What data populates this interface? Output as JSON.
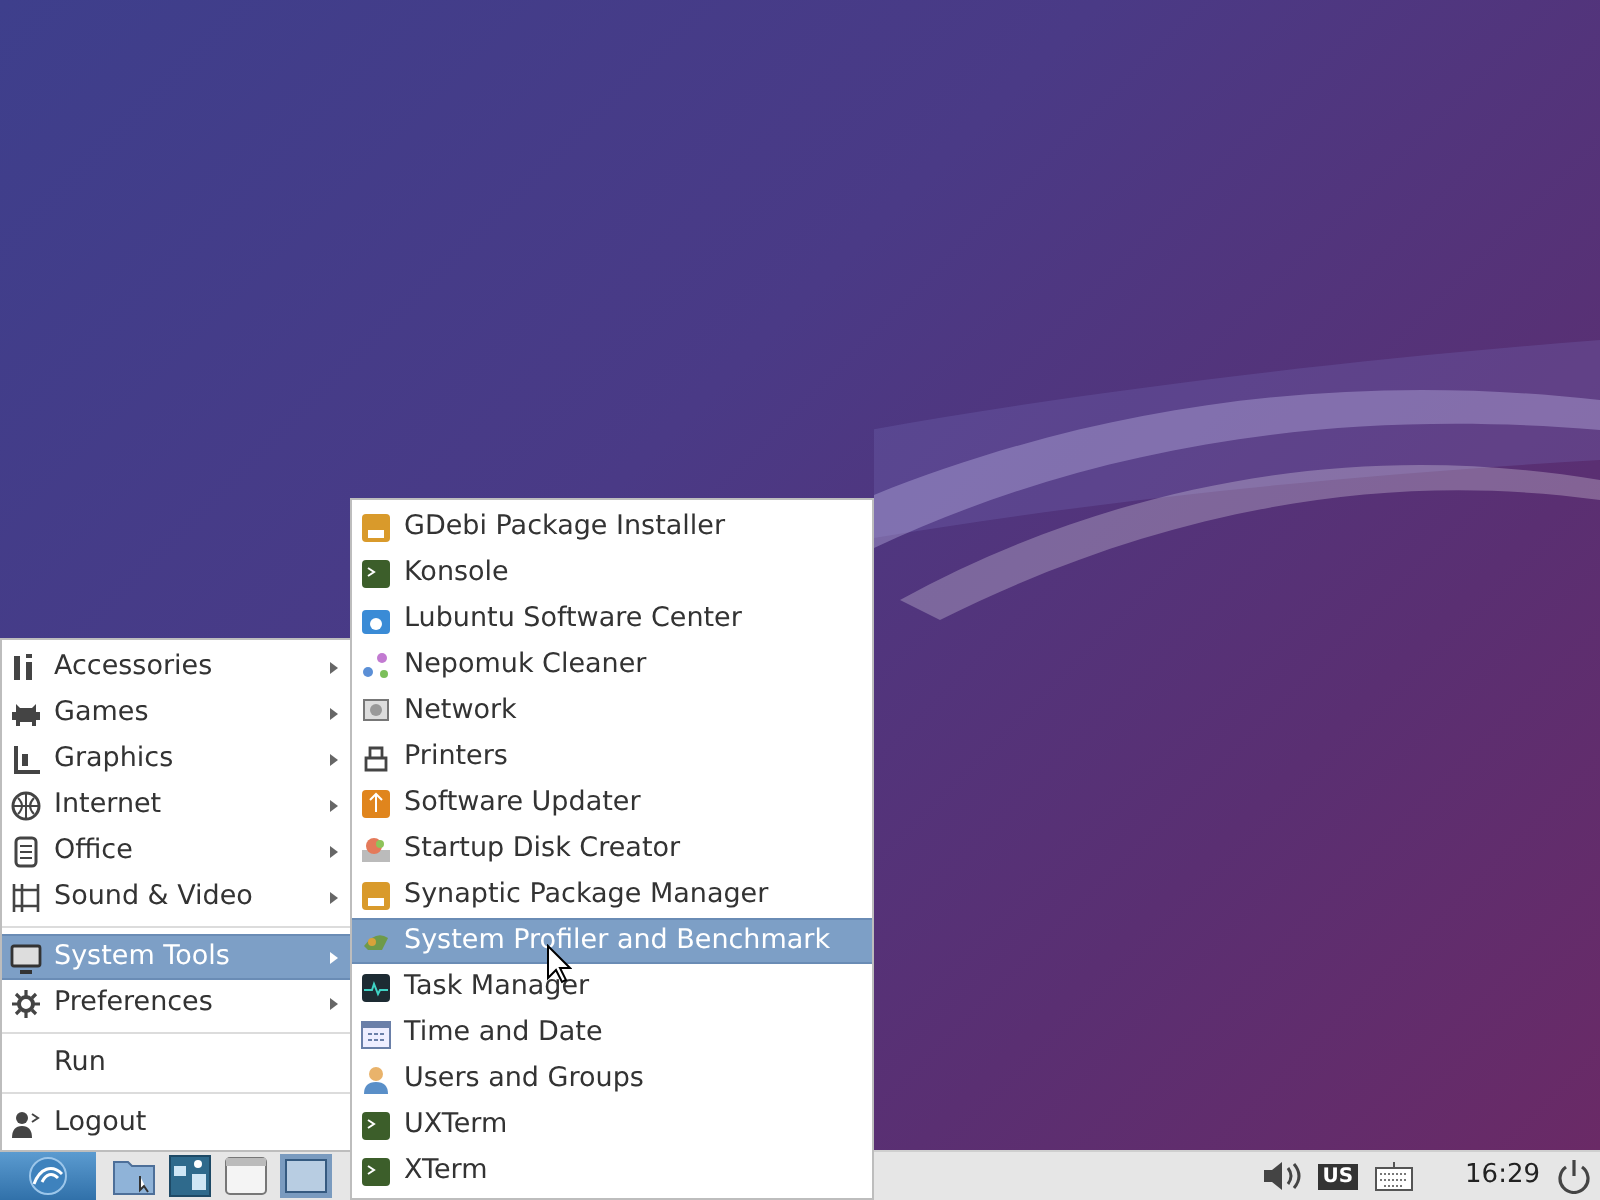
{
  "main_menu": {
    "sections": [
      {
        "items": [
          {
            "label": "Accessories",
            "submenu": true,
            "selected": false
          },
          {
            "label": "Games",
            "submenu": true,
            "selected": false
          },
          {
            "label": "Graphics",
            "submenu": true,
            "selected": false
          },
          {
            "label": "Internet",
            "submenu": true,
            "selected": false
          },
          {
            "label": "Office",
            "submenu": true,
            "selected": false
          },
          {
            "label": "Sound & Video",
            "submenu": true,
            "selected": false
          }
        ]
      },
      {
        "items": [
          {
            "label": "System Tools",
            "submenu": true,
            "selected": true
          },
          {
            "label": "Preferences",
            "submenu": true,
            "selected": false
          }
        ]
      },
      {
        "items": [
          {
            "label": "Run",
            "submenu": false,
            "selected": false
          }
        ]
      },
      {
        "items": [
          {
            "label": "Logout",
            "submenu": false,
            "selected": false
          }
        ]
      }
    ]
  },
  "submenu": {
    "items": [
      {
        "label": "GDebi Package Installer",
        "selected": false
      },
      {
        "label": "Konsole",
        "selected": false
      },
      {
        "label": "Lubuntu Software Center",
        "selected": false
      },
      {
        "label": "Nepomuk Cleaner",
        "selected": false
      },
      {
        "label": "Network",
        "selected": false
      },
      {
        "label": "Printers",
        "selected": false
      },
      {
        "label": "Software Updater",
        "selected": false
      },
      {
        "label": "Startup Disk Creator",
        "selected": false
      },
      {
        "label": "Synaptic Package Manager",
        "selected": false
      },
      {
        "label": "System Profiler and Benchmark",
        "selected": true
      },
      {
        "label": "Task Manager",
        "selected": false
      },
      {
        "label": "Time and Date",
        "selected": false
      },
      {
        "label": "Users and Groups",
        "selected": false
      },
      {
        "label": "UXTerm",
        "selected": false
      },
      {
        "label": "XTerm",
        "selected": false
      }
    ]
  },
  "taskbar": {
    "keyboard_layout": "US",
    "clock": "16:29"
  }
}
